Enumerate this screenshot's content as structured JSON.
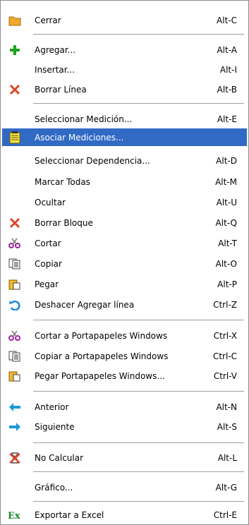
{
  "menu": {
    "items": [
      {
        "label": "Cerrar",
        "shortcut": "Alt-C",
        "icon": "folder-icon",
        "selected": false
      },
      {
        "label": "Agregar...",
        "shortcut": "Alt-A",
        "icon": "plus-icon",
        "selected": false
      },
      {
        "label": "Insertar...",
        "shortcut": "Alt-I",
        "icon": "",
        "selected": false
      },
      {
        "label": "Borrar Línea",
        "shortcut": "Alt-B",
        "icon": "delete-x-icon",
        "selected": false
      },
      {
        "label": "Seleccionar Medición...",
        "shortcut": "Alt-E",
        "icon": "",
        "selected": false
      },
      {
        "label": "Asociar Mediciones...",
        "shortcut": "",
        "icon": "notepad-icon",
        "selected": true
      },
      {
        "label": "Seleccionar Dependencia...",
        "shortcut": "Alt-D",
        "icon": "",
        "selected": false
      },
      {
        "label": "Marcar Todas",
        "shortcut": "Alt-M",
        "icon": "",
        "selected": false
      },
      {
        "label": "Ocultar",
        "shortcut": "Alt-U",
        "icon": "",
        "selected": false
      },
      {
        "label": "Borrar Bloque",
        "shortcut": "Alt-Q",
        "icon": "delete-x-icon",
        "selected": false
      },
      {
        "label": "Cortar",
        "shortcut": "Alt-T",
        "icon": "scissors-icon",
        "selected": false
      },
      {
        "label": "Copiar",
        "shortcut": "Alt-O",
        "icon": "copy-icon",
        "selected": false
      },
      {
        "label": "Pegar",
        "shortcut": "Alt-P",
        "icon": "paste-icon",
        "selected": false
      },
      {
        "label": "Deshacer Agregar línea",
        "shortcut": "Ctrl-Z",
        "icon": "undo-icon",
        "selected": false
      },
      {
        "label": "Cortar a Portapapeles Windows",
        "shortcut": "Ctrl-X",
        "icon": "scissors-icon",
        "selected": false
      },
      {
        "label": "Copiar a Portapapeles Windows",
        "shortcut": "Ctrl-C",
        "icon": "copy-icon",
        "selected": false
      },
      {
        "label": "Pegar Portapapeles Windows...",
        "shortcut": "Ctrl-V",
        "icon": "paste-icon",
        "selected": false
      },
      {
        "label": "Anterior",
        "shortcut": "Alt-N",
        "icon": "arrow-left-icon",
        "selected": false
      },
      {
        "label": "Siguiente",
        "shortcut": "Alt-S",
        "icon": "arrow-right-icon",
        "selected": false
      },
      {
        "label": "No Calcular",
        "shortcut": "Alt-L",
        "icon": "no-calc-icon",
        "selected": false
      },
      {
        "label": "Gráfico...",
        "shortcut": "Alt-G",
        "icon": "",
        "selected": false
      },
      {
        "label": "Exportar a Excel",
        "shortcut": "Ctrl-E",
        "icon": "excel-icon",
        "selected": false
      }
    ]
  },
  "colors": {
    "selection": "#316ac5",
    "separator": "#a0a0a0",
    "border": "#8c8c8c"
  }
}
